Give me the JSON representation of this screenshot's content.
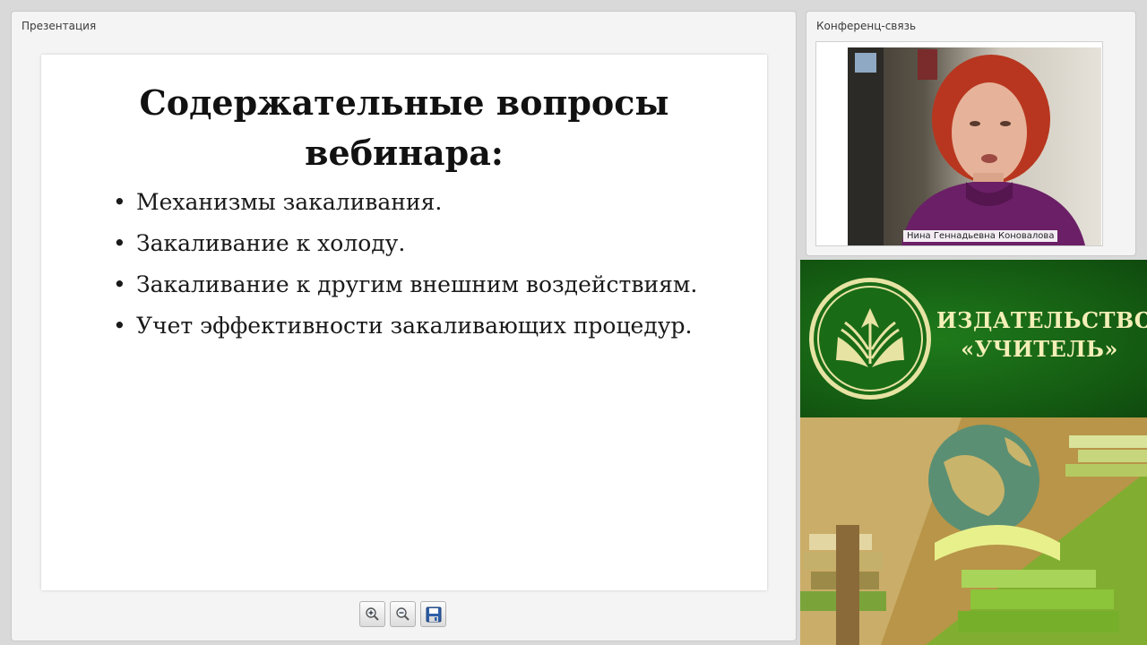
{
  "presentation": {
    "panel_title": "Презентация",
    "slide": {
      "title_line1": "Содержательные вопросы",
      "title_line2": "вебинара:",
      "bullet_glyph": "•",
      "bullets": [
        "Механизмы закаливания.",
        "Закаливание к холоду.",
        "Закаливание к другим внешним воздействиям.",
        "Учет эффективности закаливающих процедур."
      ]
    },
    "toolbar": {
      "zoom_in_icon": "zoom-in-icon",
      "zoom_out_icon": "zoom-out-icon",
      "save_icon": "save-icon"
    }
  },
  "conference": {
    "panel_title": "Конференц-связь",
    "speaker_name": "Нина Геннадьевна Коновалова"
  },
  "publisher": {
    "name_line1": "ИЗДАТЕЛЬСТВО",
    "name_line2": "«УЧИТЕЛЬ»",
    "brand_green": "#1a6b16",
    "text_color": "#f3efb7"
  }
}
